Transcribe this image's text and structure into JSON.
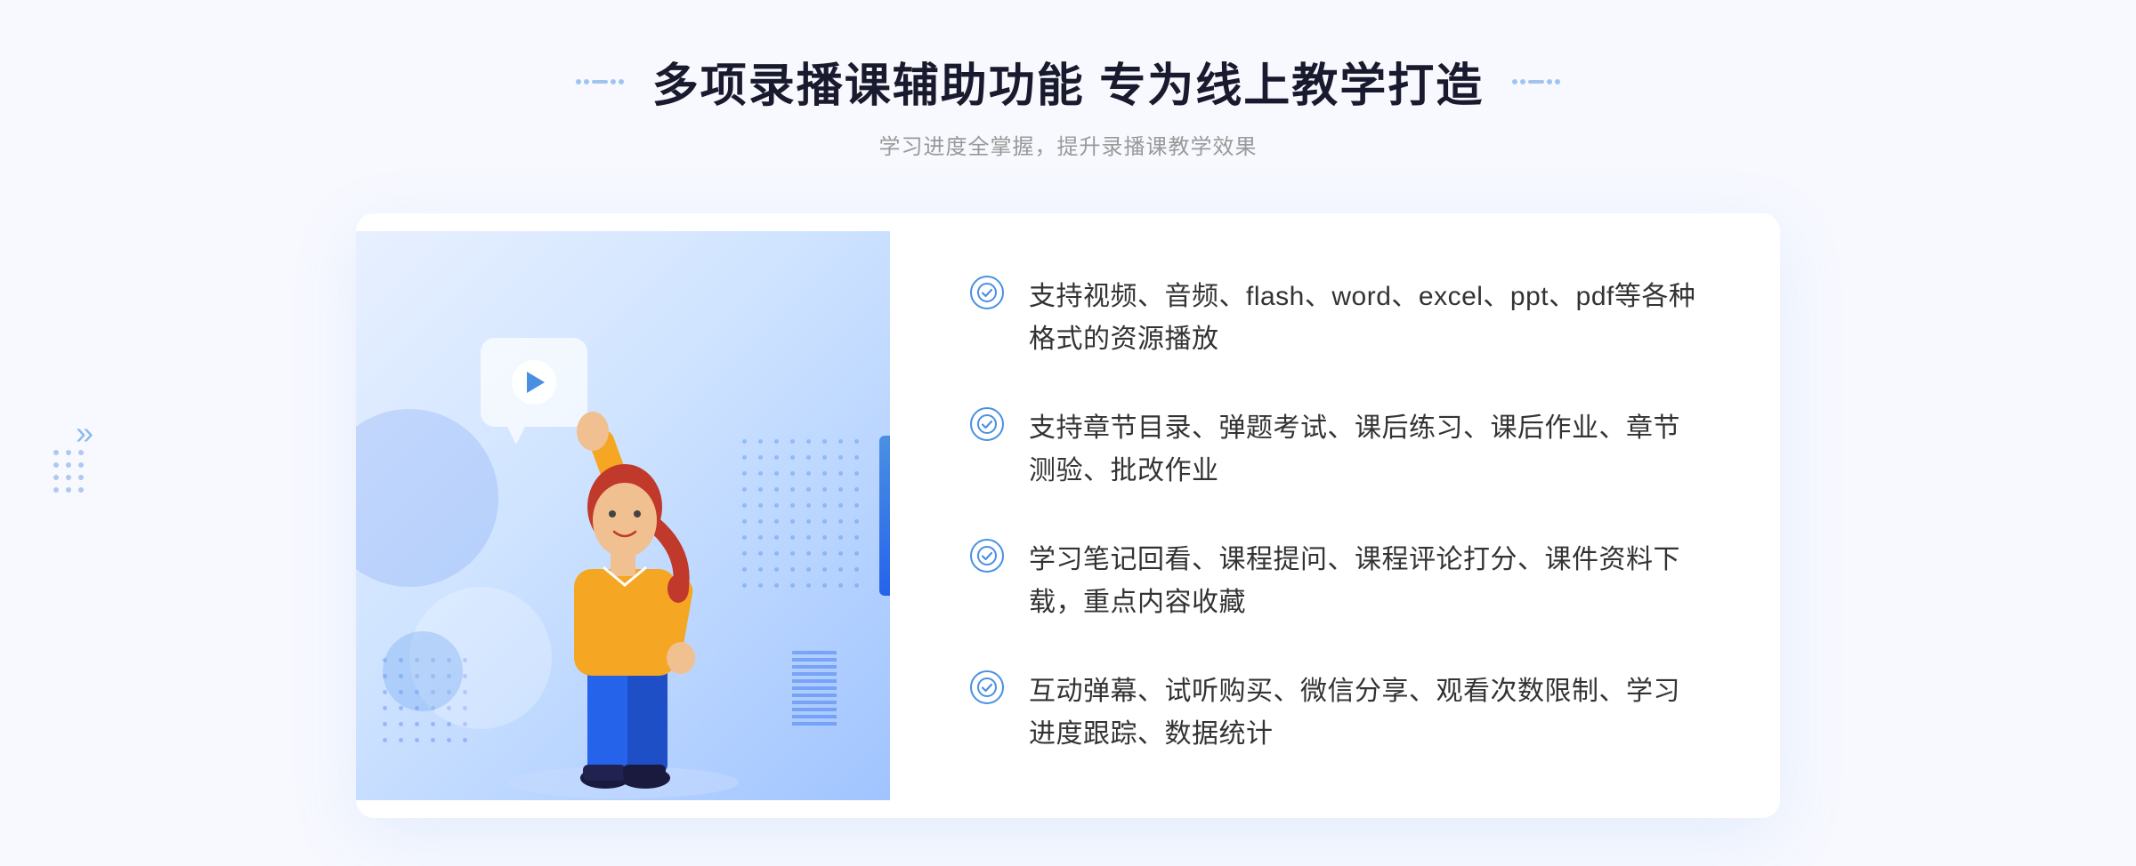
{
  "header": {
    "title": "多项录播课辅助功能 专为线上教学打造",
    "subtitle": "学习进度全掌握，提升录播课教学效果"
  },
  "features": [
    {
      "id": "feature-1",
      "text": "支持视频、音频、flash、word、excel、ppt、pdf等各种格式的资源播放"
    },
    {
      "id": "feature-2",
      "text": "支持章节目录、弹题考试、课后练习、课后作业、章节测验、批改作业"
    },
    {
      "id": "feature-3",
      "text": "学习笔记回看、课程提问、课程评论打分、课件资料下载，重点内容收藏"
    },
    {
      "id": "feature-4",
      "text": "互动弹幕、试听购买、微信分享、观看次数限制、学习进度跟踪、数据统计"
    }
  ],
  "colors": {
    "primary": "#4a90e2",
    "dark_blue": "#2563eb",
    "text_dark": "#1a1a2e",
    "text_gray": "#999999",
    "text_body": "#333333"
  },
  "decorations": {
    "left_arrow": "»",
    "check_symbol": "✓"
  }
}
